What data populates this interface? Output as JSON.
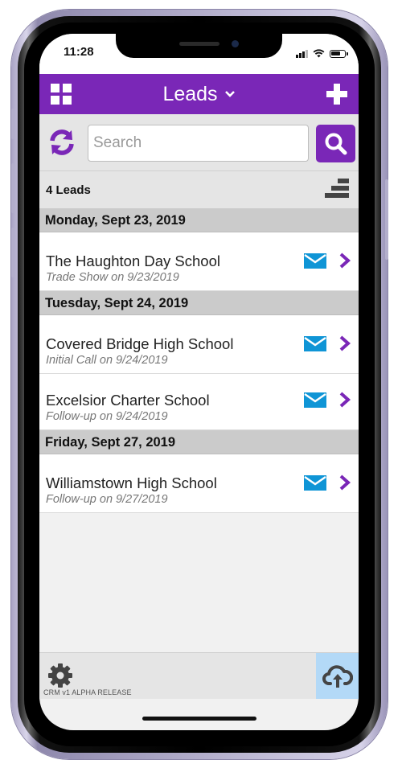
{
  "status_bar": {
    "time": "11:28"
  },
  "header": {
    "title": "Leads",
    "menu_icon": "grid-icon",
    "title_dropdown_icon": "chevron-down-icon",
    "add_icon": "plus-icon"
  },
  "search": {
    "placeholder": "Search",
    "value": "",
    "refresh_icon": "refresh-icon",
    "search_icon": "search-icon"
  },
  "summary": {
    "count_label": "4 Leads",
    "sort_icon": "sort-icon"
  },
  "groups": [
    {
      "date": "Monday, Sept 23, 2019",
      "leads": [
        {
          "name": "The Haughton Day School",
          "activity": "Trade Show on 9/23/2019"
        }
      ]
    },
    {
      "date": "Tuesday, Sept 24, 2019",
      "leads": [
        {
          "name": "Covered Bridge High School",
          "activity": "Initial Call on 9/24/2019"
        },
        {
          "name": "Excelsior Charter School",
          "activity": "Follow-up on 9/24/2019"
        }
      ]
    },
    {
      "date": "Friday, Sept 27, 2019",
      "leads": [
        {
          "name": "Williamstown High School",
          "activity": "Follow-up on 9/27/2019"
        }
      ]
    }
  ],
  "footer": {
    "version": "CRM v1 ALPHA RELEASE",
    "settings_icon": "gear-icon",
    "upload_icon": "cloud-upload-icon"
  },
  "colors": {
    "brand": "#7a27b7",
    "mail": "#0f95d6",
    "upload_bg": "#b3d9f7",
    "date_header_bg": "#cbcbcb"
  }
}
